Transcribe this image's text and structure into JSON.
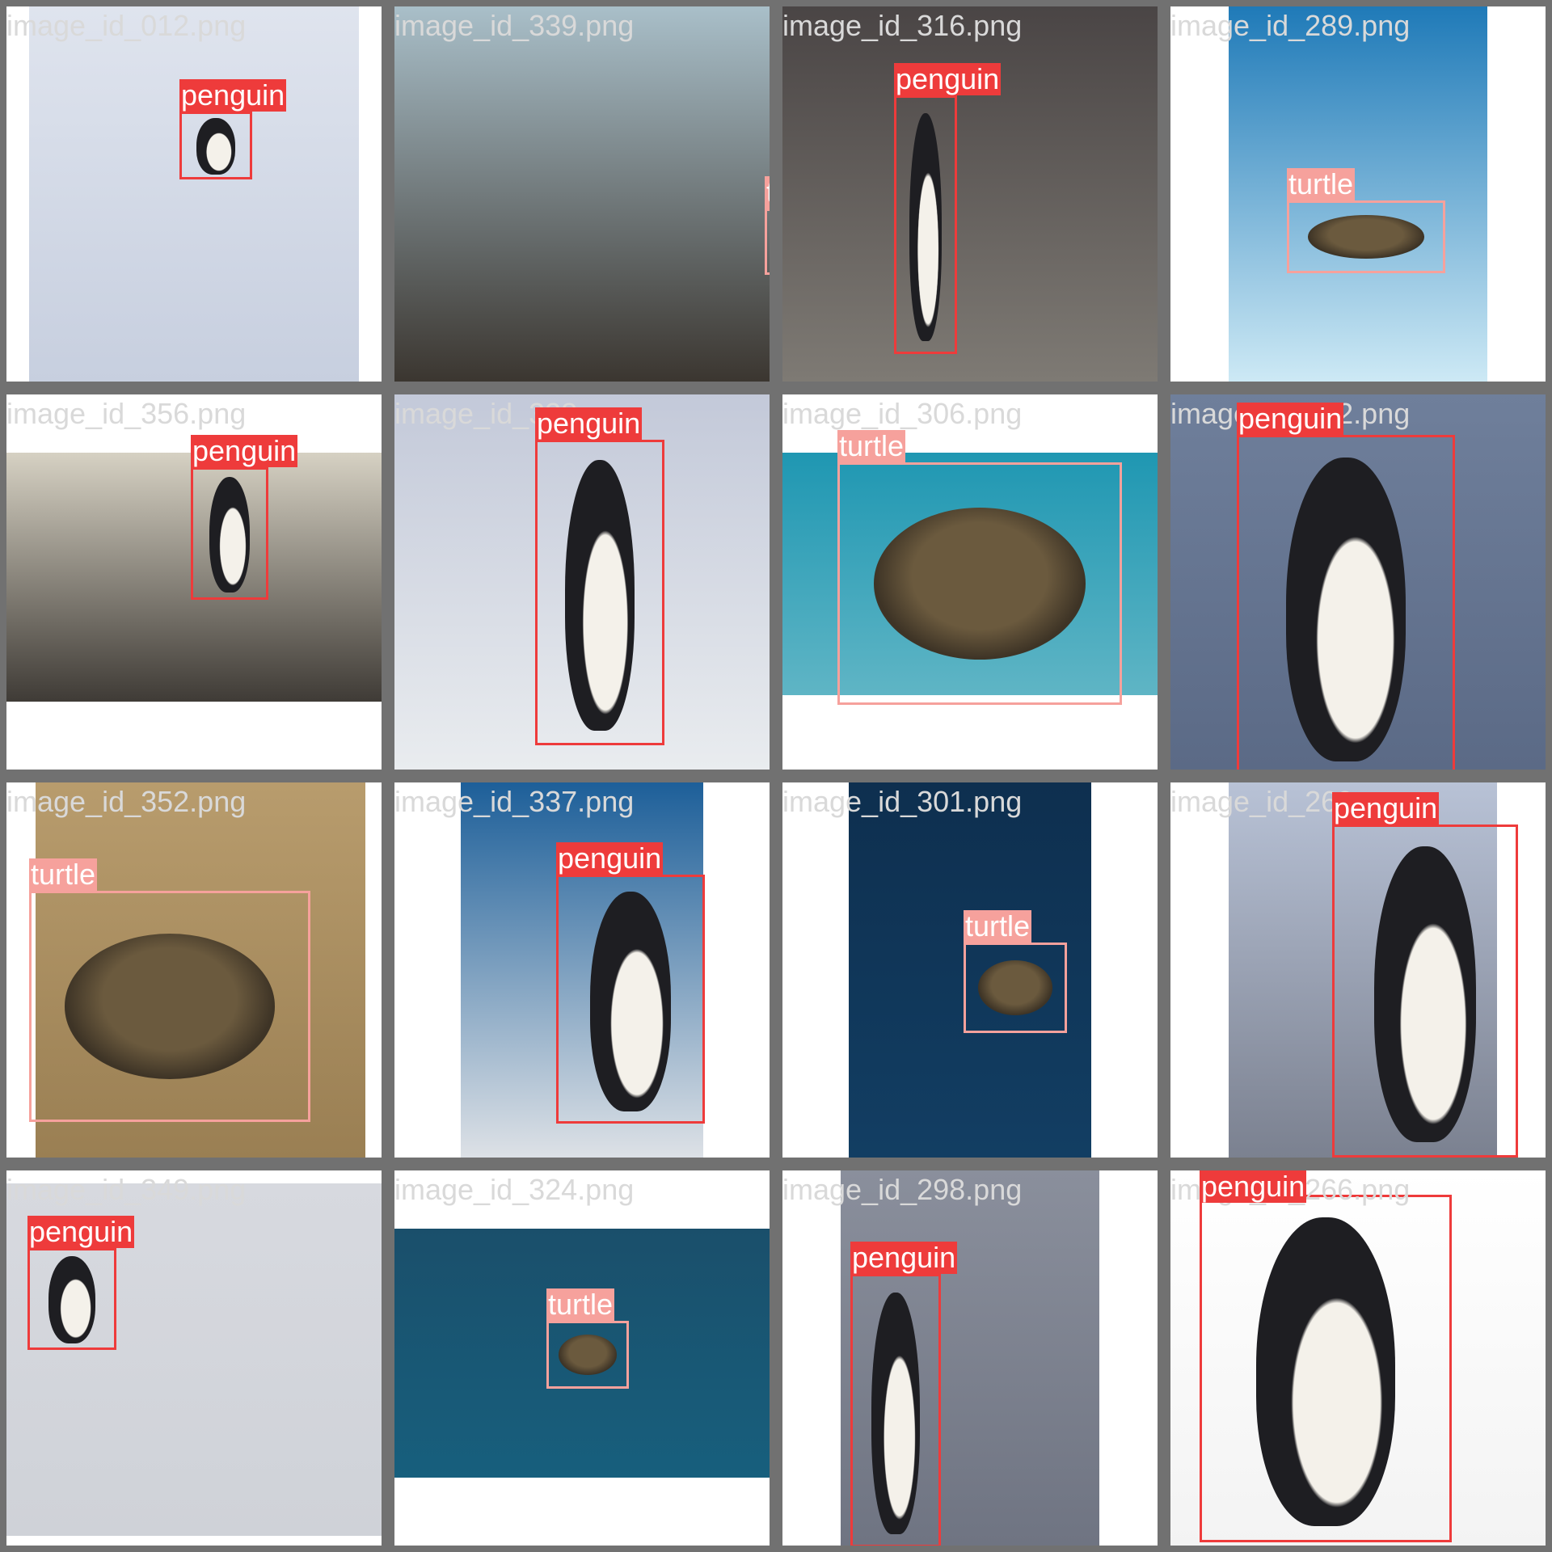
{
  "tiles": [
    {
      "filename": "image_id_012.png",
      "label": "penguin"
    },
    {
      "filename": "image_id_339.png",
      "label": "turtle"
    },
    {
      "filename": "image_id_316.png",
      "label": "penguin"
    },
    {
      "filename": "image_id_289.png",
      "label": "turtle"
    },
    {
      "filename": "image_id_356.png",
      "label": "penguin"
    },
    {
      "filename": "image_id_338.png",
      "label": "penguin"
    },
    {
      "filename": "image_id_306.png",
      "label": "turtle"
    },
    {
      "filename": "image_id_302.png",
      "label": "penguin"
    },
    {
      "filename": "image_id_352.png",
      "label": "turtle"
    },
    {
      "filename": "image_id_337.png",
      "label": "penguin"
    },
    {
      "filename": "image_id_301.png",
      "label": "turtle"
    },
    {
      "filename": "image_id_269.png",
      "label": "penguin"
    },
    {
      "filename": "image_id_349.png",
      "label": "penguin"
    },
    {
      "filename": "image_id_324.png",
      "label": "turtle"
    },
    {
      "filename": "image_id_298.png",
      "label": "penguin"
    },
    {
      "filename": "image_id_266.png",
      "label": "penguin"
    }
  ],
  "colors": {
    "penguin": "#ee3b3b",
    "turtle": "#f6a19c",
    "grid_border": "#717171",
    "filename_text": "#d9d9d9"
  }
}
